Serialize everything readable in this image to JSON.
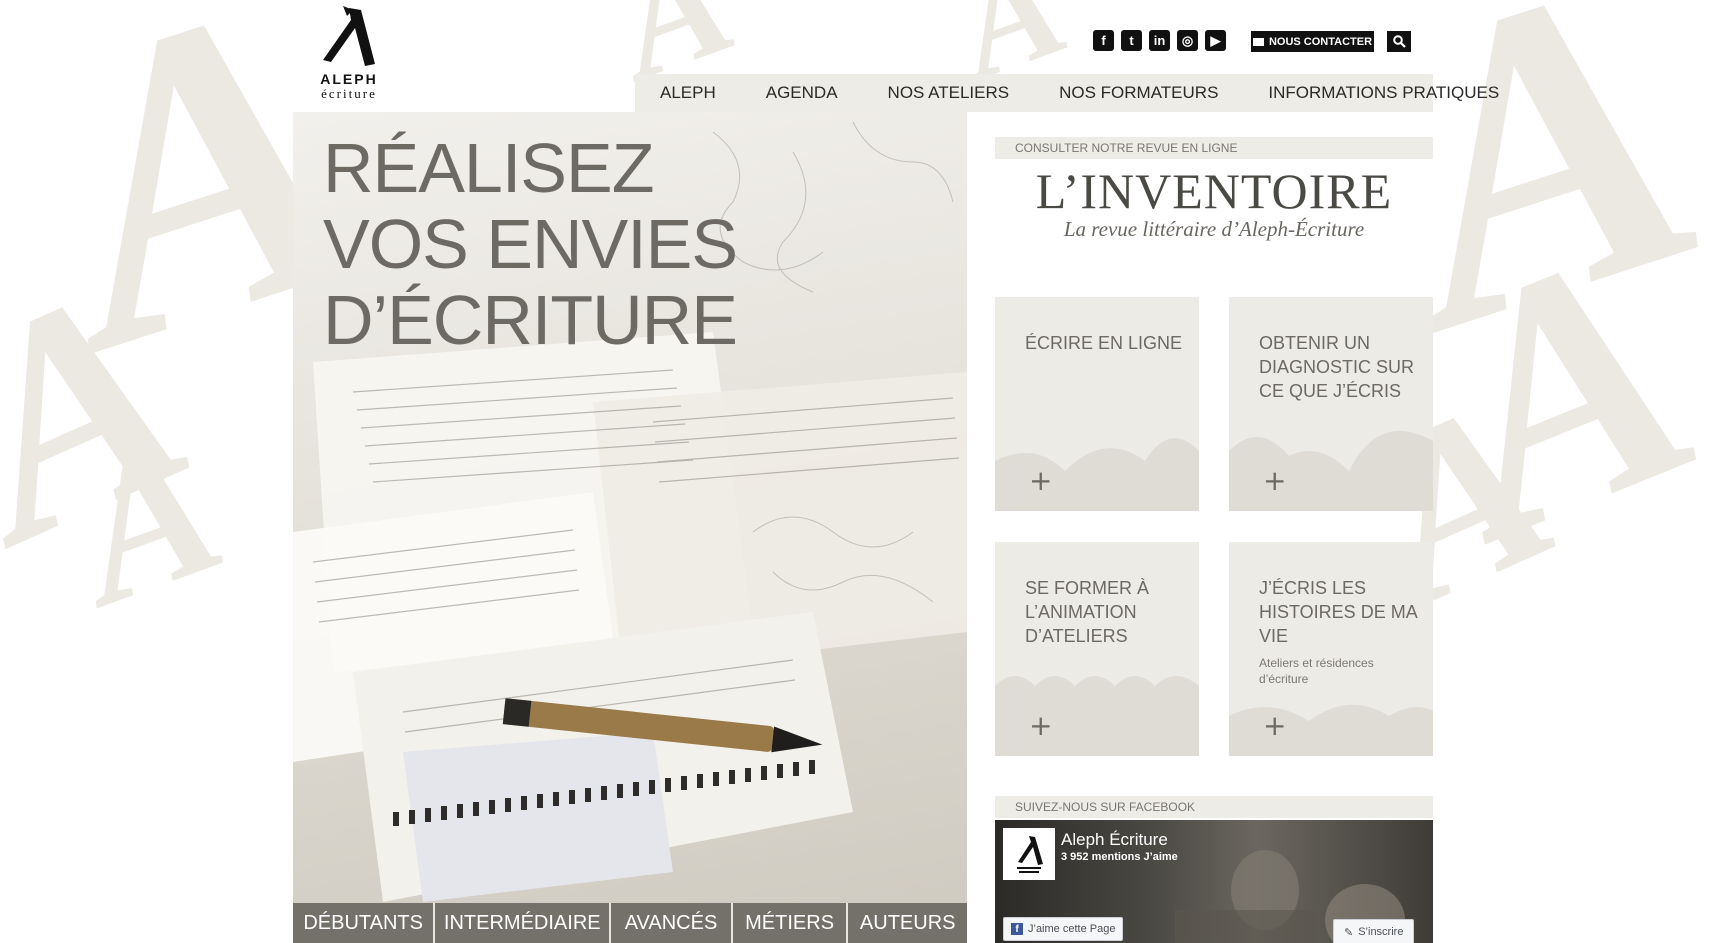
{
  "brand": {
    "logo_line1": "ALEPH",
    "logo_line2": "écriture"
  },
  "social": [
    {
      "icon": "facebook-icon",
      "glyph": "f"
    },
    {
      "icon": "twitter-icon",
      "glyph": "t"
    },
    {
      "icon": "linkedin-icon",
      "glyph": "in"
    },
    {
      "icon": "instagram-icon",
      "glyph": "◎"
    },
    {
      "icon": "youtube-icon",
      "glyph": "▶"
    }
  ],
  "header": {
    "contact_label": "NOUS CONTACTER"
  },
  "nav": [
    "ALEPH",
    "AGENDA",
    "NOS ATELIERS",
    "NOS FORMATEURS",
    "INFORMATIONS PRATIQUES"
  ],
  "hero": {
    "title_line1": "RÉALISEZ",
    "title_line2": "VOS ENVIES",
    "title_line3": "D’ÉCRITURE"
  },
  "levels": [
    "DÉBUTANTS",
    "INTERMÉDIAIRE",
    "AVANCÉS",
    "MÉTIERS",
    "AUTEURS"
  ],
  "revue": {
    "bar_label": "CONSULTER NOTRE REVUE EN LIGNE",
    "title": "L’INVENTOIRE",
    "subtitle": "La revue littéraire d’Aleph-Écriture"
  },
  "tiles": [
    {
      "title": "ÉCRIRE EN LIGNE",
      "subtitle": "",
      "plus": "+"
    },
    {
      "title": "OBTENIR UN DIAGNOSTIC SUR CE QUE J’ÉCRIS",
      "subtitle": "",
      "plus": "+"
    },
    {
      "title": "SE FORMER À L’ANIMATION D’ATELIERS",
      "subtitle": "",
      "plus": "+"
    },
    {
      "title": "J’ÉCRIS LES HISTOIRES DE MA VIE",
      "subtitle": "Ateliers et résidences d’écriture",
      "plus": "+"
    }
  ],
  "facebook": {
    "bar_label": "SUIVEZ-NOUS SUR FACEBOOK",
    "page_name": "Aleph Écriture",
    "likes": "3 952 mentions J’aime",
    "like_button": "J’aime cette Page",
    "subscribe_button": "S’inscrire"
  },
  "colors": {
    "accent_dark": "#111111",
    "panel": "#edece6",
    "text_gray": "#6d6a63",
    "levels_bg": "#74716a"
  }
}
